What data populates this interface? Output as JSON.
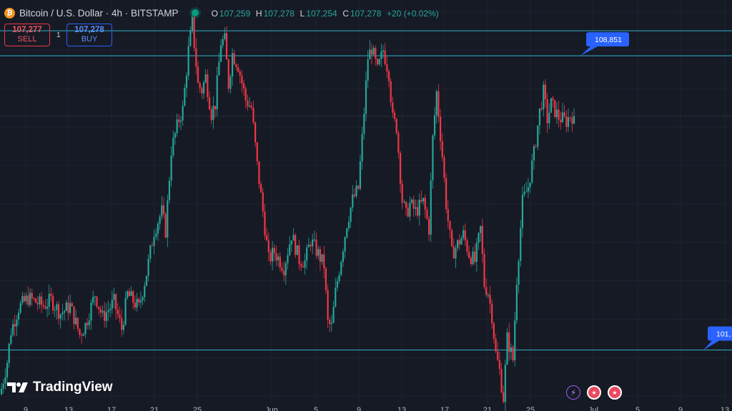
{
  "header": {
    "coin_icon": "bitcoin-icon",
    "title": "Bitcoin / U.S. Dollar · 4h · BITSTAMP",
    "ohlc": {
      "o_label": "O",
      "o": "107,259",
      "h_label": "H",
      "h": "107,278",
      "l_label": "L",
      "l": "107,254",
      "c_label": "C",
      "c": "107,278",
      "change": "+20 (+0.02%)"
    }
  },
  "trade": {
    "sell_price": "107,277",
    "sell_label": "SELL",
    "spread": "1",
    "buy_price": "107,278",
    "buy_label": "BUY"
  },
  "brand": "TradingView",
  "colors": {
    "up": "#26a69a",
    "down": "#f23645",
    "hline": "#2fb0c6",
    "label": "#2962ff",
    "background": "#161a25"
  },
  "chart_data": {
    "type": "candlestick",
    "timeframe": "4h",
    "x_tick_labels": [
      "9",
      "13",
      "17",
      "21",
      "25",
      "Jun",
      "5",
      "9",
      "13",
      "17",
      "21",
      "25",
      "Jul",
      "5",
      "9",
      "13"
    ],
    "ylim": [
      99800,
      110300
    ],
    "horizontal_lines": [
      109500,
      108851,
      101200
    ],
    "line_labels": [
      {
        "text": "108,851",
        "value": 108851
      },
      {
        "text": "101,",
        "value": 101200
      }
    ],
    "last_price_line": 107278,
    "close_path": [
      [
        0,
        100200
      ],
      [
        3,
        100900
      ],
      [
        5,
        101700
      ],
      [
        9,
        102300
      ],
      [
        14,
        102550
      ],
      [
        22,
        102350
      ],
      [
        26,
        102500
      ],
      [
        31,
        102150
      ],
      [
        36,
        102350
      ],
      [
        41,
        101600
      ],
      [
        44,
        101850
      ],
      [
        49,
        102650
      ],
      [
        53,
        102050
      ],
      [
        59,
        102450
      ],
      [
        63,
        101750
      ],
      [
        66,
        102650
      ],
      [
        72,
        102300
      ],
      [
        76,
        103200
      ],
      [
        80,
        104300
      ],
      [
        84,
        104800
      ],
      [
        86,
        104300
      ],
      [
        89,
        106400
      ],
      [
        93,
        107200
      ],
      [
        95,
        107450
      ],
      [
        98,
        109000
      ],
      [
        100,
        109700
      ],
      [
        103,
        108100
      ],
      [
        105,
        107950
      ],
      [
        107,
        108300
      ],
      [
        110,
        107350
      ],
      [
        112,
        107600
      ],
      [
        115,
        109200
      ],
      [
        117,
        109250
      ],
      [
        119,
        108100
      ],
      [
        121,
        108900
      ],
      [
        124,
        108600
      ],
      [
        128,
        107700
      ],
      [
        131,
        107500
      ],
      [
        134,
        106000
      ],
      [
        137,
        104800
      ],
      [
        140,
        103550
      ],
      [
        143,
        103750
      ],
      [
        148,
        103350
      ],
      [
        152,
        104200
      ],
      [
        156,
        103550
      ],
      [
        159,
        103500
      ],
      [
        162,
        104050
      ],
      [
        166,
        103700
      ],
      [
        169,
        103400
      ],
      [
        171,
        101900
      ],
      [
        173,
        101800
      ],
      [
        175,
        102700
      ],
      [
        177,
        103300
      ],
      [
        181,
        104500
      ],
      [
        184,
        105100
      ],
      [
        187,
        105400
      ],
      [
        189,
        106700
      ],
      [
        192,
        108800
      ],
      [
        194,
        109050
      ],
      [
        197,
        108450
      ],
      [
        200,
        109000
      ],
      [
        203,
        108400
      ],
      [
        205,
        107200
      ],
      [
        207,
        107000
      ],
      [
        210,
        105100
      ],
      [
        212,
        104700
      ],
      [
        214,
        105000
      ],
      [
        217,
        104800
      ],
      [
        221,
        105050
      ],
      [
        224,
        104350
      ],
      [
        226,
        106700
      ],
      [
        228,
        107900
      ],
      [
        231,
        106250
      ],
      [
        233,
        105000
      ],
      [
        236,
        103700
      ],
      [
        239,
        103950
      ],
      [
        242,
        104200
      ],
      [
        245,
        103700
      ],
      [
        248,
        103500
      ],
      [
        251,
        104350
      ],
      [
        253,
        102900
      ],
      [
        255,
        102700
      ],
      [
        257,
        102100
      ],
      [
        259,
        101100
      ],
      [
        261,
        100650
      ],
      [
        263,
        99950
      ],
      [
        265,
        101500
      ],
      [
        268,
        100950
      ],
      [
        270,
        103050
      ],
      [
        273,
        105050
      ],
      [
        276,
        105450
      ],
      [
        279,
        106300
      ],
      [
        282,
        107400
      ],
      [
        284,
        107900
      ],
      [
        286,
        107200
      ],
      [
        288,
        107600
      ],
      [
        292,
        107250
      ],
      [
        296,
        107150
      ],
      [
        298,
        107300
      ],
      [
        300,
        107278
      ]
    ]
  },
  "icons": {
    "bolt": "bolt-icon",
    "flag1": "us-flag-icon",
    "flag2": "us-flag-icon"
  }
}
